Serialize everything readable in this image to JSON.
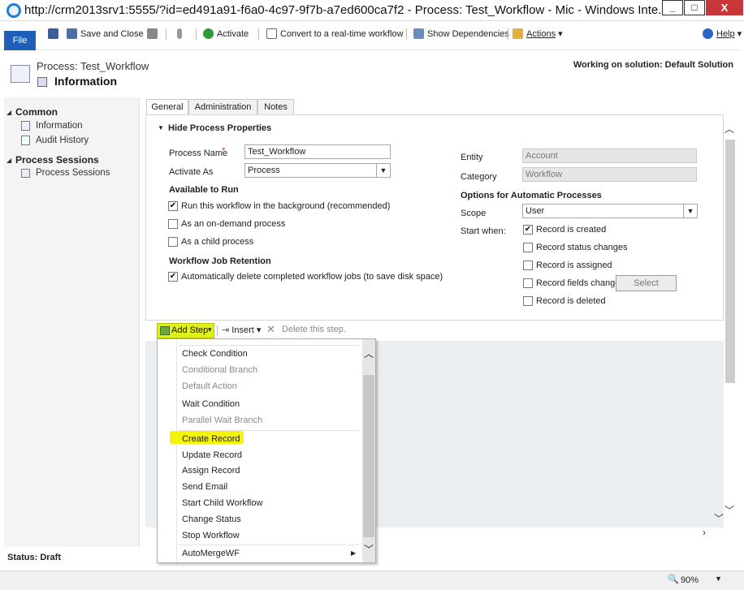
{
  "window": {
    "title": "http://crm2013srv1:5555/?id=ed491a91-f6a0-4c97-9f7b-a7ed600ca7f2 - Process: Test_Workflow - Mic - Windows Inte...",
    "minimize": "_",
    "maximize": "□",
    "close": "X"
  },
  "ribbon": {
    "file": "File",
    "save_close": "Save and Close",
    "activate": "Activate",
    "convert": "Convert to a real-time workflow",
    "show_dependencies": "Show Dependencies",
    "actions": "Actions",
    "help": "Help"
  },
  "header": {
    "process_title": "Process: Test_Workflow",
    "page_title": "Information",
    "solution": "Working on solution: Default Solution"
  },
  "nav": {
    "common": "Common",
    "information": "Information",
    "audit_history": "Audit History",
    "process_sessions_heading": "Process Sessions",
    "process_sessions": "Process Sessions"
  },
  "tabs": [
    "General",
    "Administration",
    "Notes"
  ],
  "form": {
    "section": "Hide Process Properties",
    "process_name_label": "Process Name",
    "required_mark": "*",
    "process_name_value": "Test_Workflow",
    "activate_as_label": "Activate As",
    "activate_as_value": "Process",
    "available_to_run": "Available to Run",
    "opt_background": "Run this workflow in the background (recommended)",
    "opt_ondemand": "As an on-demand process",
    "opt_child": "As a child process",
    "retention_heading": "Workflow Job Retention",
    "opt_autodelete": "Automatically delete completed workflow jobs (to save disk space)",
    "entity_label": "Entity",
    "entity_value": "Account",
    "category_label": "Category",
    "category_value": "Workflow",
    "auto_heading": "Options for Automatic Processes",
    "scope_label": "Scope",
    "scope_value": "User",
    "start_when_label": "Start when:",
    "sw_created": "Record is created",
    "sw_status": "Record status changes",
    "sw_assigned": "Record is assigned",
    "sw_fields": "Record fields change",
    "select_button": "Select",
    "sw_deleted": "Record is deleted"
  },
  "checks": {
    "background": true,
    "ondemand": false,
    "child": false,
    "autodelete": true,
    "created": true,
    "status": false,
    "assigned": false,
    "fields": false,
    "deleted": false
  },
  "step_toolbar": {
    "add_step": "Add Step",
    "insert": "Insert",
    "delete": "Delete this step."
  },
  "menu": {
    "check_condition": "Check Condition",
    "conditional_branch": "Conditional Branch",
    "default_action": "Default Action",
    "wait_condition": "Wait Condition",
    "parallel_wait_branch": "Parallel Wait Branch",
    "create_record": "Create Record",
    "update_record": "Update Record",
    "assign_record": "Assign Record",
    "send_email": "Send Email",
    "start_child_workflow": "Start Child Workflow",
    "change_status": "Change Status",
    "stop_workflow": "Stop Workflow",
    "automergewf": "AutoMergeWF"
  },
  "status": {
    "text": "Status: Draft",
    "zoom": "90%"
  },
  "colors": {
    "file_blue": "#1f5fb7",
    "highlight_yellow": "#f4f40a",
    "close_red": "#c7373a"
  }
}
